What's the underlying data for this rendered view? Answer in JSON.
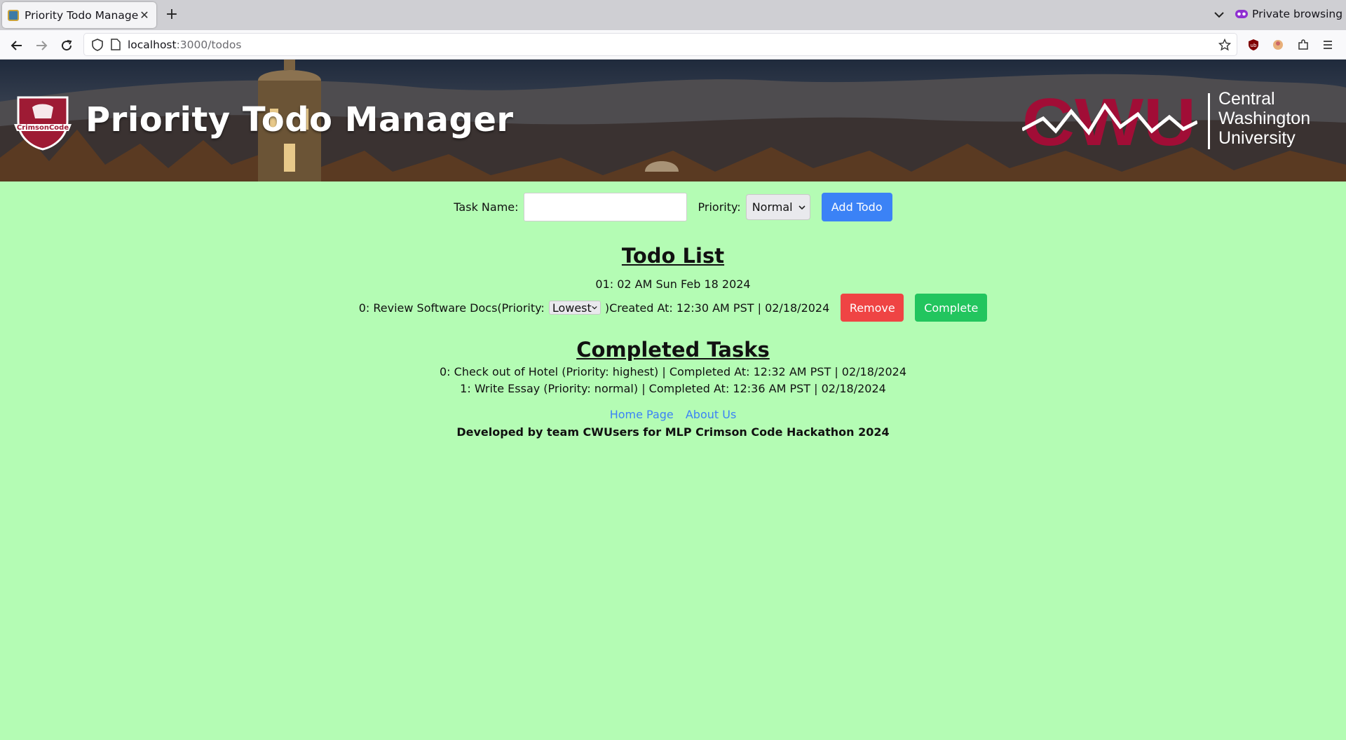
{
  "browser": {
    "tab_title": "Priority Todo Manager",
    "url_host": "localhost",
    "url_path": ":3000/todos",
    "private_label": "Private browsing"
  },
  "banner": {
    "title": "Priority Todo Manager",
    "crest_text": "CrimsonCode",
    "cwu_letters": "CWU",
    "cwu_name_lines": [
      "Central",
      "Washington",
      "University"
    ],
    "colors": {
      "cwu_red": "#a10d36"
    }
  },
  "form": {
    "task_label": "Task Name:",
    "task_value": "",
    "priority_label": "Priority:",
    "priority_selected": "Normal",
    "add_button": "Add Todo"
  },
  "todo": {
    "heading": "Todo List",
    "clock": "01: 02 AM  Sun Feb 18 2024",
    "items": [
      {
        "prefix": "0: Review Software Docs(Priority:",
        "priority": "Lowest",
        "suffix": ")Created At: 12:30 AM PST | 02/18/2024",
        "remove_label": "Remove",
        "complete_label": "Complete"
      }
    ]
  },
  "completed": {
    "heading": "Completed Tasks",
    "items": [
      "0: Check out of Hotel (Priority: highest) | Completed At: 12:32 AM PST | 02/18/2024",
      "1: Write Essay (Priority: normal) | Completed At: 12:36 AM PST | 02/18/2024"
    ]
  },
  "footer": {
    "links": [
      "Home Page",
      "About Us"
    ],
    "credit": "Developed by team CWUsers for MLP Crimson Code Hackathon 2024"
  },
  "colors": {
    "page_background": "#b4fcb4",
    "add_button": "#3b82f6",
    "remove_button": "#ef4444",
    "complete_button": "#22c55e"
  }
}
